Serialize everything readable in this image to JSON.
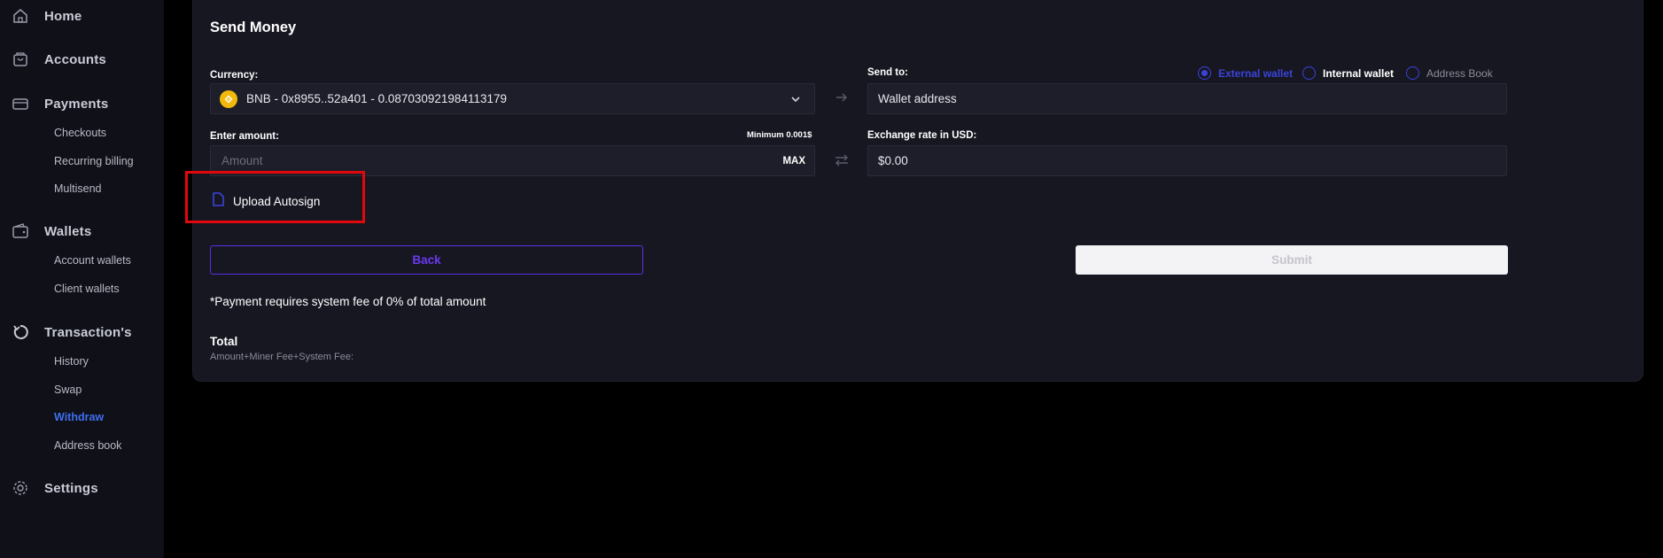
{
  "sidebar": {
    "items": [
      {
        "label": "Home",
        "icon": "home-icon"
      },
      {
        "label": "Accounts",
        "icon": "accounts-icon"
      },
      {
        "label": "Payments",
        "icon": "payments-icon"
      },
      {
        "label": "Wallets",
        "icon": "wallet-icon"
      },
      {
        "label": "Transaction's",
        "icon": "history-icon"
      },
      {
        "label": "Settings",
        "icon": "gear-icon"
      }
    ],
    "payments_sub": [
      "Checkouts",
      "Recurring billing",
      "Multisend"
    ],
    "wallets_sub": [
      "Account wallets",
      "Client wallets"
    ],
    "transactions_sub": [
      "History",
      "Swap",
      "Withdraw",
      "Address book"
    ],
    "active_sub": "Withdraw"
  },
  "form": {
    "title": "Send Money",
    "currency_label": "Currency:",
    "currency_value": "BNB - 0x8955..52a401 - 0.087030921984113179",
    "send_to_label": "Send to:",
    "wallet_placeholder": "Wallet address",
    "radio_options": [
      "External wallet",
      "Internal wallet",
      "Address Book"
    ],
    "radio_selected": "External wallet",
    "amount_label": "Enter amount:",
    "minimum": "Minimum 0.001$",
    "amount_placeholder": "Amount",
    "max_label": "MAX",
    "exchange_label": "Exchange rate in USD:",
    "exchange_value": "$0.00",
    "upload_label": "Upload Autosign",
    "back_label": "Back",
    "submit_label": "Submit",
    "fee_note": "*Payment requires system fee of 0% of total amount",
    "total_label": "Total",
    "total_sub": "Amount+Miner Fee+System Fee:"
  },
  "colors": {
    "accent": "#3a43d9",
    "active_nav": "#3f6ff0",
    "back_button": "#6a39f0",
    "highlight": "#e0080b",
    "bnb": "#f0b90b"
  }
}
